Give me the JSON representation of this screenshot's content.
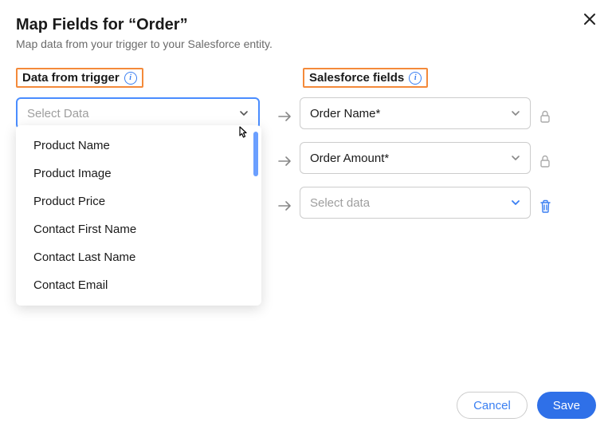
{
  "header": {
    "title": "Map Fields for “Order”",
    "subtitle": "Map data from your trigger to your Salesforce entity."
  },
  "columns": {
    "left_label": "Data from trigger",
    "right_label": "Salesforce fields"
  },
  "trigger_select_placeholder": "Select Data",
  "dropdown_options": [
    "Product Name",
    "Product Image",
    "Product Price",
    "Contact First Name",
    "Contact Last Name",
    "Contact Email"
  ],
  "salesforce_rows": [
    {
      "value": "Order Name*",
      "end_icon": "lock"
    },
    {
      "value": "Order Amount*",
      "end_icon": "lock"
    },
    {
      "placeholder": "Select data",
      "end_icon": "trash",
      "blue_chevron": true
    }
  ],
  "footer": {
    "cancel": "Cancel",
    "save": "Save"
  }
}
